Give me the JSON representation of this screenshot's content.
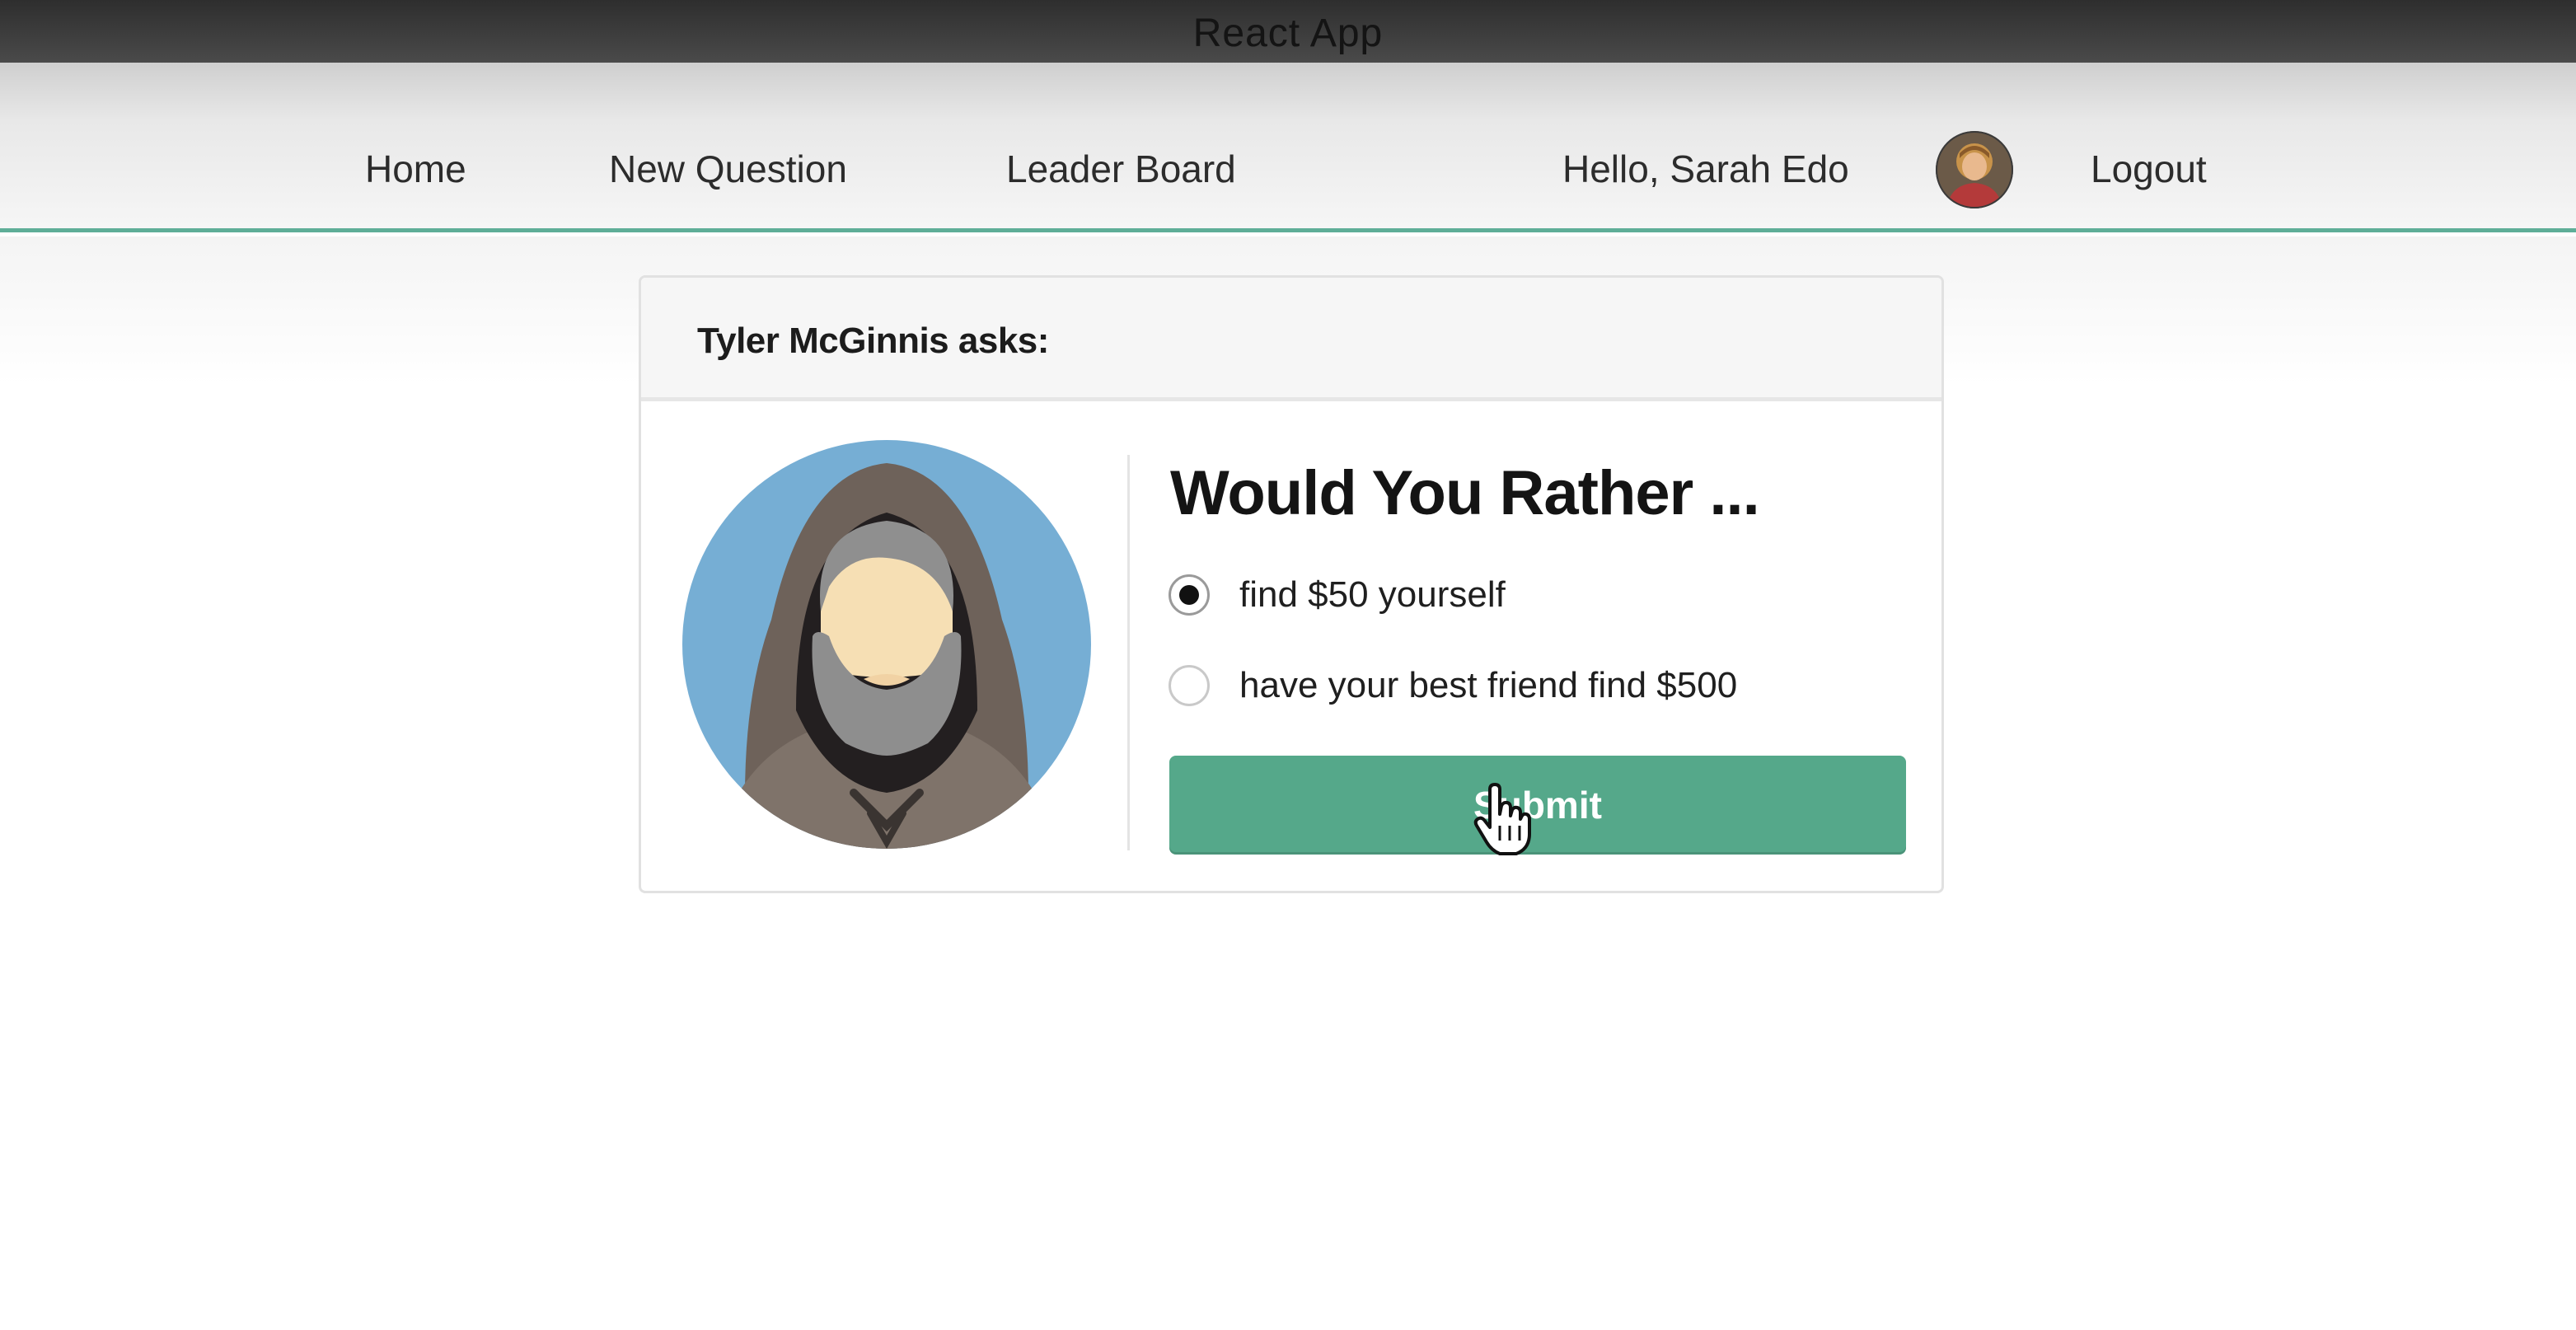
{
  "window": {
    "title": "React App"
  },
  "nav": {
    "items": [
      {
        "label": "Home"
      },
      {
        "label": "New Question"
      },
      {
        "label": "Leader Board"
      }
    ],
    "greeting": "Hello, Sarah Edo",
    "avatar_icon": "user-avatar-icon",
    "logout_label": "Logout",
    "accent_color": "#5fae98"
  },
  "question": {
    "asker": "Tyler McGinnis asks:",
    "author_avatar_icon": "hooded-bearded-man-avatar-icon",
    "title": "Would You Rather ...",
    "options": [
      {
        "label": "find $50 yourself",
        "selected": true
      },
      {
        "label": "have your best friend find $500",
        "selected": false
      }
    ],
    "submit_label": "Submit",
    "button_color": "#55a88a"
  },
  "pointer": {
    "icon": "hand-pointer-icon"
  }
}
